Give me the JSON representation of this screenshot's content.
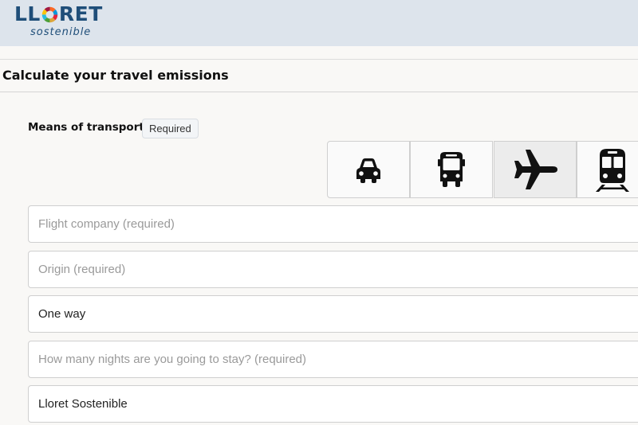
{
  "header": {
    "logo_text_before": "LL",
    "logo_text_after": "RET",
    "logo_subtitle": "sostenible",
    "brand_color": "#1f4e79"
  },
  "page": {
    "title": "Calculate your travel emissions"
  },
  "transport": {
    "label": "Means of transport",
    "badge": "Required",
    "options": [
      {
        "icon": "car-icon",
        "selected": false
      },
      {
        "icon": "bus-icon",
        "selected": false
      },
      {
        "icon": "airplane-icon",
        "selected": true
      },
      {
        "icon": "train-icon",
        "selected": false
      }
    ]
  },
  "form": {
    "flight_company_placeholder": "Flight company (required)",
    "origin_placeholder": "Origin (required)",
    "trip_type_value": "One way",
    "nights_placeholder": "How many nights are you going to stay? (required)",
    "destination_value": "Lloret Sostenible"
  }
}
